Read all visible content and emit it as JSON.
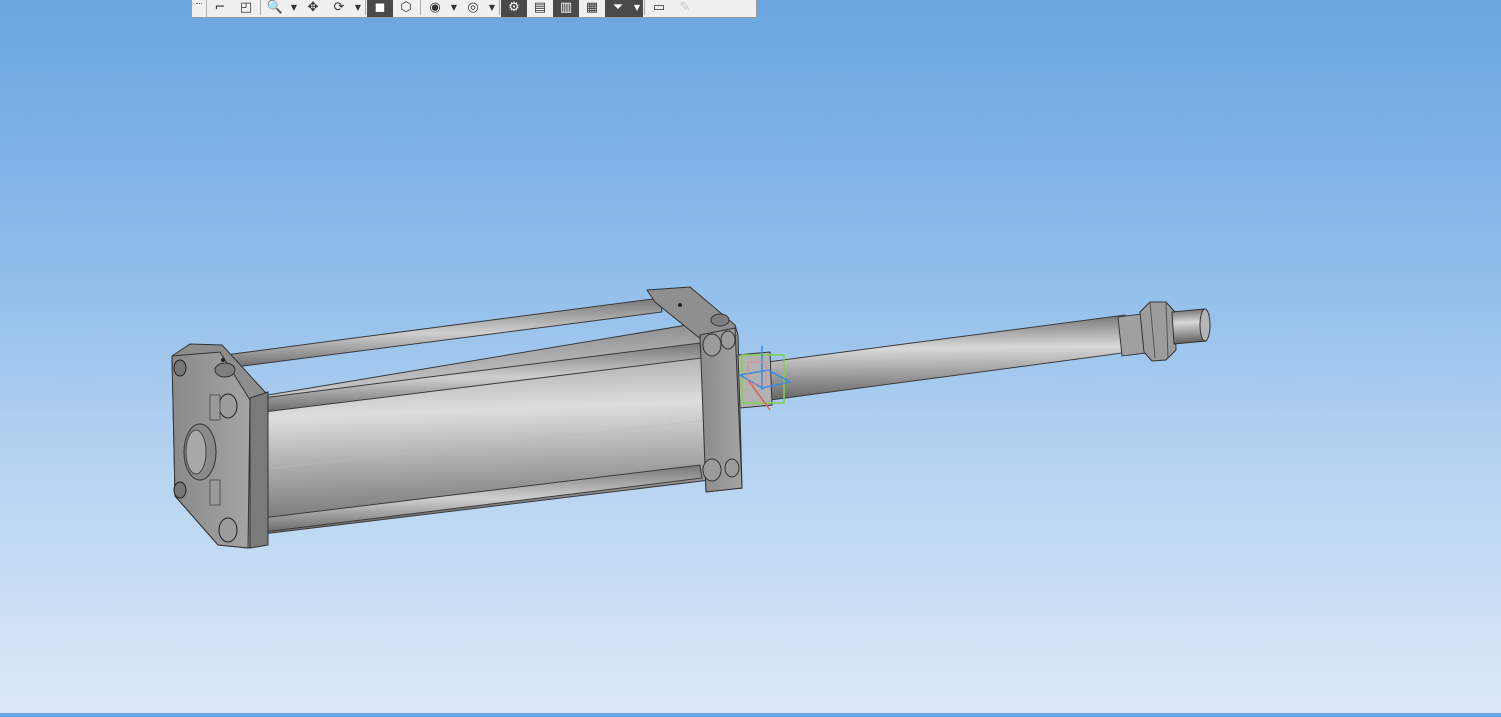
{
  "toolbar": {
    "buttons": [
      {
        "name": "sketch-icon",
        "glyph": "⌐"
      },
      {
        "name": "orientation-icon",
        "glyph": "◰"
      },
      {
        "name": "zoom-icon",
        "glyph": "🔍"
      },
      {
        "name": "pan-icon",
        "glyph": "✥"
      },
      {
        "name": "rotate-icon",
        "glyph": "⟳"
      },
      {
        "name": "shaded-view-icon",
        "glyph": "◼"
      },
      {
        "name": "wireframe-view-icon",
        "glyph": "⬡"
      },
      {
        "name": "hide-icon",
        "glyph": "◉"
      },
      {
        "name": "section-view-icon",
        "glyph": "◎"
      },
      {
        "name": "constraints-icon",
        "glyph": "⚙"
      },
      {
        "name": "sheet-icon",
        "glyph": "▤"
      },
      {
        "name": "select-icon",
        "glyph": "▥"
      },
      {
        "name": "properties-icon",
        "glyph": "▦"
      },
      {
        "name": "filter-icon",
        "glyph": "⏷"
      },
      {
        "name": "measure-icon",
        "glyph": "▭"
      },
      {
        "name": "pencil-icon",
        "glyph": "✎"
      }
    ]
  },
  "viewport": {
    "background_top": "#6aa6e0",
    "background_bottom": "#dce9f8",
    "model_color": "#9a9a9a"
  }
}
